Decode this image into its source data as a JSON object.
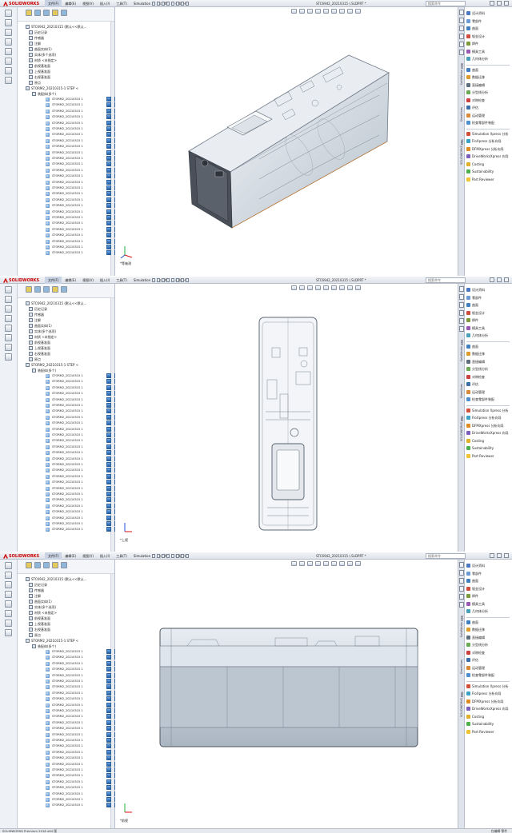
{
  "app": {
    "brand": "SOLIDWORKS",
    "title_text": "SOLIDWORKS Premium 2018 x64 版"
  },
  "menu": [
    "文件(F)",
    "编辑(E)",
    "视图(V)",
    "插入(I)",
    "工具(T)",
    "Simulation",
    "窗口(W)",
    "帮助(H)"
  ],
  "document": {
    "title": "STC6942_20210315 (.SLDPRT *"
  },
  "search": {
    "placeholder": "搜索命令"
  },
  "tree": {
    "root": "STC6942_20210315 (默认<<默认...",
    "items": [
      "历史记录",
      "传感器",
      "注解",
      "曲面实体(1)",
      "实体(多个选项)",
      "材质 <未指定>",
      "前视基准面",
      "上视基准面",
      "右视基准面",
      "原点"
    ],
    "group": "STORM2_20210315-1 STEP <",
    "subgroup": "装配体(多个)",
    "part_label": "STORM2_20210315 1"
  },
  "right_panel": {
    "tabs_vertical": [
      "SolidWorks 内容",
      "Sheetlines",
      "SOLIDWORKS 插件"
    ],
    "items": [
      {
        "label": "设计资料",
        "color": "#4a79c4"
      },
      {
        "label": "零部件",
        "color": "#6b9ad6"
      },
      {
        "label": "曲面",
        "color": "#3f7fc2"
      },
      {
        "label": "钣金设计",
        "color": "#cf4c3c"
      },
      {
        "label": "焊件",
        "color": "#7c9a3a"
      },
      {
        "label": "模具工具",
        "color": "#9b59b6"
      },
      {
        "label": "几何体分析",
        "color": "#4aa0b8"
      },
      {
        "label": "曲面",
        "color": "#3f7fc2"
      },
      {
        "label": "数据迁移",
        "color": "#e09a2b"
      },
      {
        "label": "直接编辑",
        "color": "#5d6e7e"
      },
      {
        "label": "分型线分析",
        "color": "#6aaa55"
      },
      {
        "label": "对称检查",
        "color": "#cc3f3f"
      },
      {
        "label": "评估",
        "color": "#3b6ea8"
      },
      {
        "label": "运动管理",
        "color": "#d9883a"
      },
      {
        "label": "检查零部件装配",
        "color": "#4d8fd1"
      },
      {
        "label": "Simulation Xpress 分析",
        "color": "#d24f3a"
      },
      {
        "label": "FloXpress 分析向导",
        "color": "#3aa1c9"
      },
      {
        "label": "DFMXpress 分析向导",
        "color": "#e08a22"
      },
      {
        "label": "DriveWorksXpress 向导",
        "color": "#7d5dbd"
      },
      {
        "label": "Costing",
        "color": "#e0b02a"
      },
      {
        "label": "Sustainability",
        "color": "#4caf50"
      },
      {
        "label": "Part Reviewer",
        "color": "#f1c232"
      }
    ]
  },
  "viewports": [
    {
      "view": "isometric",
      "triad_label": "*等轴测"
    },
    {
      "view": "top",
      "triad_label": "*上视"
    },
    {
      "view": "front",
      "triad_label": "*前视"
    }
  ],
  "status": {
    "left": "SOLIDWORKS Premium 2018 x64 版",
    "right": "在编辑 零件"
  }
}
